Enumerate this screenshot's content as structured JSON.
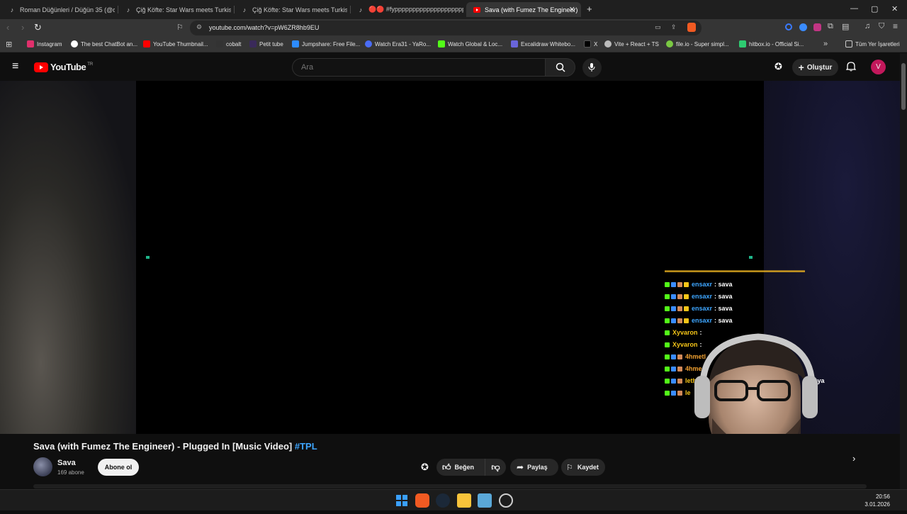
{
  "browser": {
    "tabs": [
      {
        "title": "Roman Düğünleri / Düğün 35 (@dug",
        "icon": "tiktok-icon",
        "active": false
      },
      {
        "title": "Çiğ Köfte: Star Wars meets Turkish Sp",
        "icon": "tiktok-icon",
        "active": false
      },
      {
        "title": "Çiğ Köfte: Star Wars meets Turkish Sp",
        "icon": "tiktok-icon",
        "active": false
      },
      {
        "title": "🔴🔴 #fypppppppppppppppppppp",
        "icon": "tiktok-icon",
        "active": false
      },
      {
        "title": "Sava (with Fumez The Engineer)",
        "icon": "youtube-icon",
        "active": true
      }
    ],
    "new_tab_symbol": "+",
    "url": "youtube.com/watch?v=pW6ZR8hb9EU",
    "bookmarks": [
      {
        "label": "Instagram",
        "color": "#e1306c"
      },
      {
        "label": "The best ChatBot an...",
        "color": "#ffffff"
      },
      {
        "label": "YouTube Thumbnail...",
        "color": "#ff0000"
      },
      {
        "label": "cobalt",
        "color": "#cfcfcf"
      },
      {
        "label": "Petit tube",
        "color": "#3a2a5a"
      },
      {
        "label": "Jumpshare: Free File...",
        "color": "#2d8cff"
      },
      {
        "label": "Watch Era31 - YaRo...",
        "color": "#4a6cf7"
      },
      {
        "label": "Watch Global & Loc...",
        "color": "#53fc18"
      },
      {
        "label": "Excalidraw Whitebo...",
        "color": "#6965db"
      },
      {
        "label": "X",
        "color": "#000000"
      },
      {
        "label": "Vite + React + TS",
        "color": "#bbbbbb"
      },
      {
        "label": "file.io - Super simpl...",
        "color": "#7ac943"
      },
      {
        "label": "hitbox.io - Official Si...",
        "color": "#2ecc71"
      }
    ],
    "all_bookmarks_label": "Tüm Yer İşaretleri"
  },
  "youtube": {
    "logo_text": "YouTube",
    "logo_region": "TR",
    "search_placeholder": "Ara",
    "create_label": "Oluştur",
    "avatar_letter": "V",
    "avatar_color": "#c2185b"
  },
  "chat": [
    {
      "user": "ensaxr",
      "msg": ": sava",
      "color": "#3ea6ff"
    },
    {
      "user": "ensaxr",
      "msg": ": sava",
      "color": "#3ea6ff"
    },
    {
      "user": "ensaxr",
      "msg": ": sava",
      "color": "#3ea6ff"
    },
    {
      "user": "ensaxr",
      "msg": ": sava",
      "color": "#3ea6ff"
    },
    {
      "user": "Xyvaron",
      "msg": ":",
      "color": "#f5c518"
    },
    {
      "user": "Xyvaron",
      "msg": ":",
      "color": "#f5c518"
    },
    {
      "user": "4hmetl",
      "msg": "",
      "color": "#f0a030"
    },
    {
      "user": "4hme",
      "msg": "",
      "color": "#f0a030"
    },
    {
      "user": "leth",
      "msg": "e aq ya",
      "color": "#f5c518"
    },
    {
      "user": "le",
      "msg": "",
      "color": "#f5c518"
    }
  ],
  "video": {
    "title": "Sava (with Fumez The Engineer) - Plugged In [Music Video]",
    "hashtag": "#TPL",
    "channel": "Sava",
    "subscribers": "169 abone",
    "subscribe_label": "Abone ol",
    "like_label": "Beğen",
    "share_label": "Paylaş",
    "save_label": "Kaydet"
  },
  "taskbar": {
    "time": "20:56",
    "date": "3.01.2026"
  }
}
